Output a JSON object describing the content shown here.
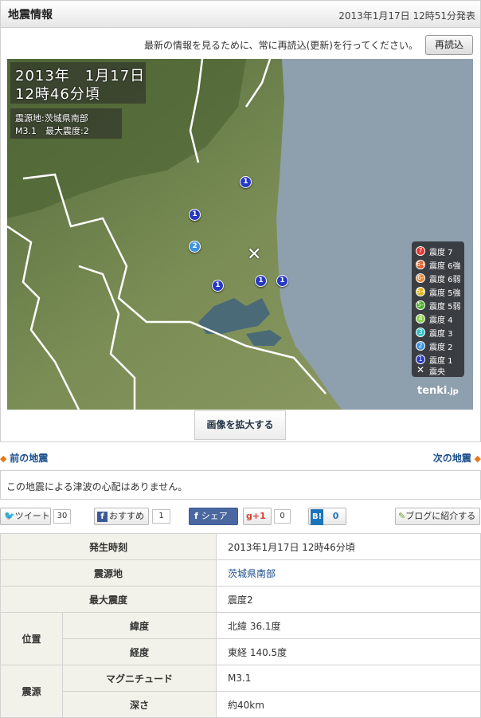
{
  "header": {
    "title": "地震情報",
    "issued": "2013年1月17日 12時51分発表"
  },
  "reload": {
    "text": "最新の情報を見るために、常に再読込(更新)を行ってください。",
    "button": "再読込"
  },
  "map": {
    "date": "2013年　1月17日",
    "time": "12時46分頃",
    "epicenter": "震源地:茨城県南部",
    "magnitude_line": "M3.1　最大震度:2",
    "legend": [
      {
        "icon": "7",
        "label": "震度 7",
        "color": "#e8332a"
      },
      {
        "icon": "6+",
        "label": "震度 6強",
        "color": "#e0622a"
      },
      {
        "icon": "6-",
        "label": "震度 6弱",
        "color": "#e98431"
      },
      {
        "icon": "5+",
        "label": "震度 5強",
        "color": "#e2b421"
      },
      {
        "icon": "5-",
        "label": "震度 5弱",
        "color": "#4cae2a"
      },
      {
        "icon": "4",
        "label": "震度 4",
        "color": "#8ad14b"
      },
      {
        "icon": "3",
        "label": "震度 3",
        "color": "#32c1c6"
      },
      {
        "icon": "2",
        "label": "震度 2",
        "color": "#3d93de"
      },
      {
        "icon": "1",
        "label": "震度 1",
        "color": "#2638c4"
      },
      {
        "icon": "x",
        "label": "震央",
        "color": "#ffffff"
      }
    ],
    "brand": "tenki",
    "brand_suffix": ".jp",
    "pins": [
      {
        "label": "1",
        "color": "#2638c4"
      },
      {
        "label": "1",
        "color": "#2638c4"
      },
      {
        "label": "2",
        "color": "#3d93de"
      },
      {
        "label": "1",
        "color": "#2638c4"
      },
      {
        "label": "1",
        "color": "#2638c4"
      },
      {
        "label": "1",
        "color": "#2638c4"
      }
    ],
    "enlarge_button": "画像を拡大する"
  },
  "nav": {
    "prev": "前の地震",
    "next": "次の地震"
  },
  "tsunami_notice": "この地震による津波の心配はありません。",
  "social": {
    "tweet": "ツイート",
    "tweet_count": "30",
    "recommend": "おすすめ",
    "recommend_count": "1",
    "share": "シェア",
    "gplus": "+1",
    "gplus_count": "0",
    "hatena": "B!",
    "hatena_count": "0",
    "blog": "ブログに紹介する"
  },
  "details": {
    "time_label": "発生時刻",
    "time_value": "2013年1月17日 12時46分頃",
    "area_label": "震源地",
    "area_value": "茨城県南部",
    "max_label": "最大震度",
    "max_value": "震度2",
    "position_label": "位置",
    "lat_label": "緯度",
    "lat_value": "北緯 36.1度",
    "lon_label": "経度",
    "lon_value": "東経 140.5度",
    "source_label": "震源",
    "mag_label": "マグニチュード",
    "mag_value": "M3.1",
    "depth_label": "深さ",
    "depth_value": "約40km"
  }
}
